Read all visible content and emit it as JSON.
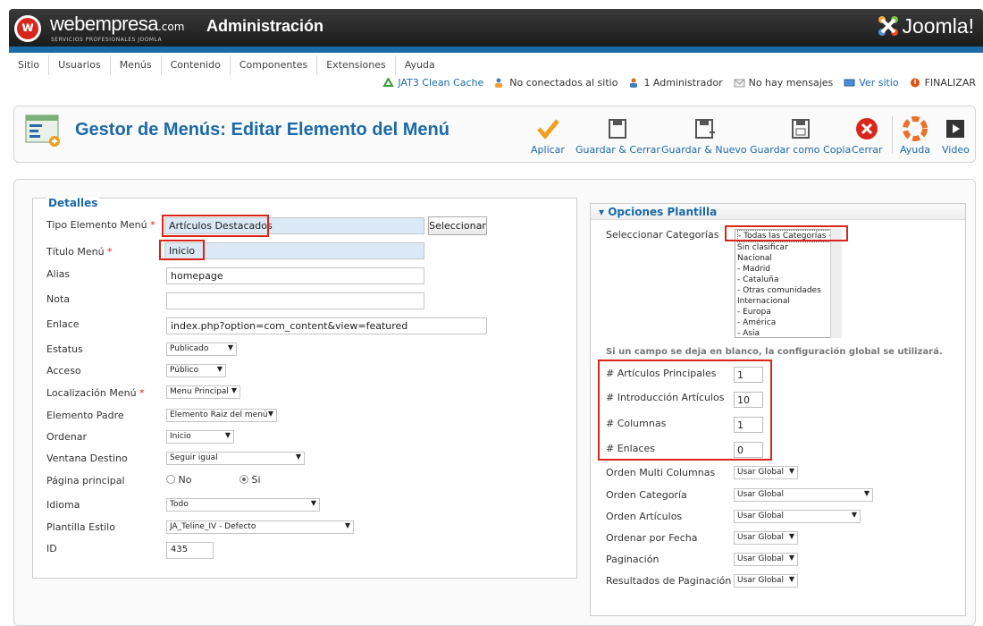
{
  "header": {
    "brand": "webempresa",
    "brand_suffix": ".com",
    "brand_tagline": "SERVICIOS PROFESIONALES JOOMLA",
    "title": "Administración",
    "joomla": "Joomla!"
  },
  "nav": [
    "Sitio",
    "Usuarios",
    "Menús",
    "Contenido",
    "Componentes",
    "Extensiones",
    "Ayuda"
  ],
  "status": {
    "cache": "JAT3 Clean Cache",
    "connected": "No conectados al sitio",
    "admins": "1 Administrador",
    "messages": "No hay mensajes",
    "view_site": "Ver sitio",
    "logout": "FINALIZAR"
  },
  "toolbar": {
    "title": "Gestor de Menús: Editar Elemento del Menú",
    "apply": "Aplicar",
    "save_close": "Guardar & Cerrar",
    "save_new": "Guardar & Nuevo",
    "save_copy": "Guardar como Copia",
    "close": "Cerrar",
    "help": "Ayuda",
    "video": "Video"
  },
  "details": {
    "legend": "Detalles",
    "type_label": "Tipo Elemento Menú",
    "type_value": "Artículos Destacados",
    "select_button": "Seleccionar",
    "title_label": "Título Menú",
    "title_value": "Inicio",
    "alias_label": "Alias",
    "alias_value": "homepage",
    "note_label": "Nota",
    "note_value": "",
    "link_label": "Enlace",
    "link_value": "index.php?option=com_content&view=featured",
    "status_label": "Estatus",
    "status_value": "Publicado",
    "access_label": "Acceso",
    "access_value": "Público",
    "location_label": "Localización Menú",
    "location_value": "Menu Principal",
    "parent_label": "Elemento Padre",
    "parent_value": "Elemento Raiz del menú",
    "order_label": "Ordenar",
    "order_value": "Inicio",
    "target_label": "Ventana Destino",
    "target_value": "Seguir igual",
    "home_label": "Página principal",
    "home_no": "No",
    "home_yes": "Si",
    "lang_label": "Idioma",
    "lang_value": "Todo",
    "style_label": "Plantilla Estilo",
    "style_value": "JA_Teline_IV - Defecto",
    "id_label": "ID",
    "id_value": "435",
    "required_mark": "*"
  },
  "options": {
    "title": "Opciones Plantilla",
    "categories_label": "Seleccionar Categorías",
    "categories": [
      "- Todas las Categorías -",
      "Sin clasificar",
      "Nacional",
      "- Madrid",
      "- Cataluña",
      "- Otras comunidades",
      "Internacional",
      "- Europa",
      "- América",
      "- Asia"
    ],
    "note": "Si un campo se deja en blanco, la configuración global se utilizará.",
    "leading_label": "# Artículos Principales",
    "leading_value": "1",
    "intro_label": "# Introducción Artículos",
    "intro_value": "10",
    "columns_label": "# Columnas",
    "columns_value": "1",
    "links_label": "# Enlaces",
    "links_value": "0",
    "multicol_label": "Orden Multi Columnas",
    "multicol_value": "Usar Global",
    "catorder_label": "Orden Categoría",
    "catorder_value": "Usar Global",
    "artorder_label": "Orden Artículos",
    "artorder_value": "Usar Global",
    "date_label": "Ordenar por Fecha",
    "date_value": "Usar Global",
    "pagination_label": "Paginación",
    "pagination_value": "Usar Global",
    "pagresults_label": "Resultados de Paginación",
    "pagresults_value": "Usar Global"
  },
  "colors": {
    "accent_blue": "#1b6aa8",
    "highlight_red": "#d9261c",
    "header_dark": "#2a2a2a"
  }
}
